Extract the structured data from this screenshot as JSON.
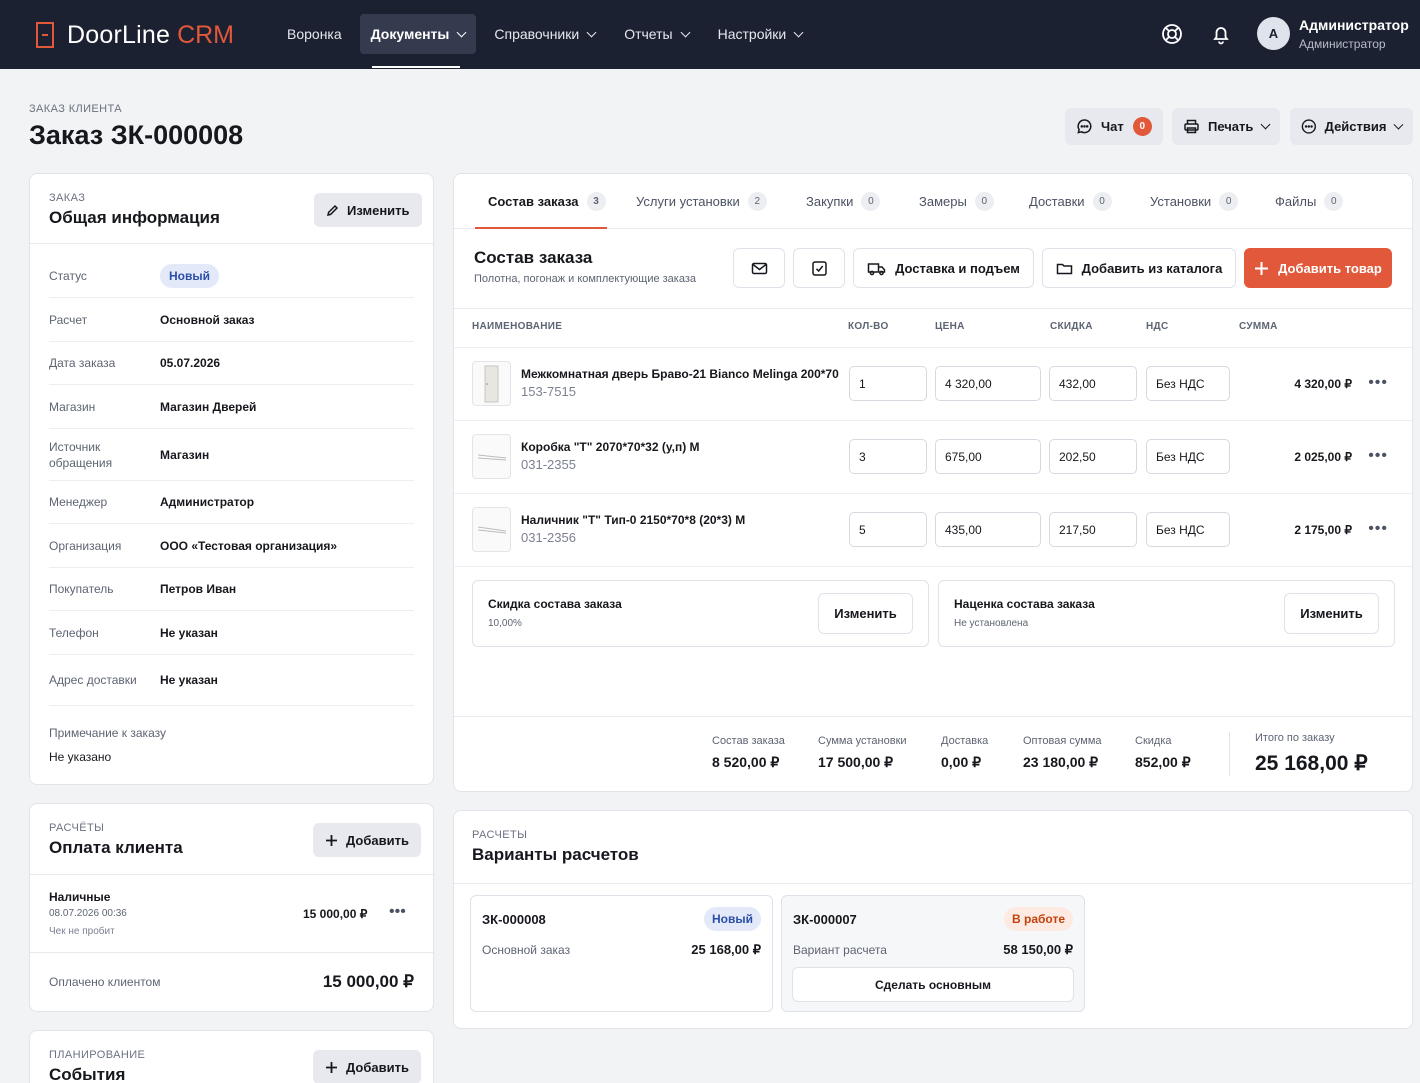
{
  "app": {
    "logo": "DoorLine",
    "logo_accent": "CRM"
  },
  "nav": [
    {
      "label": "Воронка"
    },
    {
      "label": "Документы"
    },
    {
      "label": "Справочники"
    },
    {
      "label": "Отчеты"
    },
    {
      "label": "Настройки"
    }
  ],
  "user": {
    "initial": "А",
    "name": "Администратор",
    "role": "Администратор"
  },
  "header": {
    "crumb": "ЗАКАЗ КЛИЕНТА",
    "title": "Заказ ЗК-000008",
    "chat": "Чат",
    "chat_count": "0",
    "print": "Печать",
    "actions": "Действия"
  },
  "info": {
    "label": "ЗАКАЗ",
    "title": "Общая информация",
    "edit": "Изменить",
    "rows": [
      {
        "k": "Статус",
        "v": "Новый"
      },
      {
        "k": "Расчет",
        "v": "Основной заказ"
      },
      {
        "k": "Дата заказа",
        "v": "05.07.2026"
      },
      {
        "k": "Магазин",
        "v": "Магазин Дверей"
      },
      {
        "k": "Источник обращения",
        "v": "Магазин"
      },
      {
        "k": "Менеджер",
        "v": "Администратор"
      },
      {
        "k": "Организация",
        "v": "ООО «Тестовая организация»"
      },
      {
        "k": "Покупатель",
        "v": "Петров Иван"
      },
      {
        "k": "Телефон",
        "v": "Не указан"
      },
      {
        "k": "Адрес доставки",
        "v": "Не указан"
      }
    ],
    "note_label": "Примечание к заказу",
    "note": "Не указано"
  },
  "payments": {
    "label": "РАСЧЁТЫ",
    "title": "Оплата клиента",
    "add": "Добавить",
    "item": {
      "type": "Наличные",
      "date": "08.07.2026 00:36",
      "check": "Чек не пробит",
      "amount": "15 000,00 ₽"
    },
    "paid_label": "Оплачено клиентом",
    "paid": "15 000,00 ₽"
  },
  "planning": {
    "label": "ПЛАНИРОВАНИЕ",
    "title": "События",
    "add": "Добавить"
  },
  "tabs": [
    {
      "label": "Состав заказа",
      "count": "3"
    },
    {
      "label": "Услуги установки",
      "count": "2"
    },
    {
      "label": "Закупки",
      "count": "0"
    },
    {
      "label": "Замеры",
      "count": "0"
    },
    {
      "label": "Доставки",
      "count": "0"
    },
    {
      "label": "Установки",
      "count": "0"
    },
    {
      "label": "Файлы",
      "count": "0"
    }
  ],
  "composition": {
    "title": "Состав заказа",
    "subtitle": "Полотна, погонаж и комплектующие заказа",
    "btn_delivery": "Доставка и подъем",
    "btn_catalog": "Добавить из каталога",
    "btn_add": "Добавить товар",
    "columns": {
      "name": "НАИМЕНОВАНИЕ",
      "qty": "КОЛ-ВО",
      "price": "ЦЕНА",
      "discount": "СКИДКА",
      "vat": "НДС",
      "sum": "СУММА"
    },
    "items": [
      {
        "name": "Межкомнатная дверь Браво-21 Bianco Melinga 200*70",
        "sku": "153-7515",
        "qty": "1",
        "price": "4 320,00",
        "discount": "432,00",
        "vat": "Без НДС",
        "sum": "4 320,00 ₽"
      },
      {
        "name": "Коробка \"Т\" 2070*70*32 (у,п) М",
        "sku": "031-2355",
        "qty": "3",
        "price": "675,00",
        "discount": "202,50",
        "vat": "Без НДС",
        "sum": "2 025,00 ₽"
      },
      {
        "name": "Наличник \"Т\" Тип-0 2150*70*8 (20*3) М",
        "sku": "031-2356",
        "qty": "5",
        "price": "435,00",
        "discount": "217,50",
        "vat": "Без НДС",
        "sum": "2 175,00 ₽"
      }
    ],
    "discount_card": {
      "title": "Скидка состава заказа",
      "value": "10,00%",
      "btn": "Изменить"
    },
    "markup_card": {
      "title": "Наценка состава заказа",
      "value": "Не установлена",
      "btn": "Изменить"
    },
    "totals": [
      {
        "label": "Состав заказа",
        "value": "8 520,00 ₽"
      },
      {
        "label": "Сумма установки",
        "value": "17 500,00 ₽"
      },
      {
        "label": "Доставка",
        "value": "0,00 ₽"
      },
      {
        "label": "Оптовая сумма",
        "value": "23 180,00 ₽"
      },
      {
        "label": "Скидка",
        "value": "852,00 ₽"
      }
    ],
    "grand_label": "Итого по заказу",
    "grand": "25 168,00 ₽"
  },
  "variants": {
    "label": "РАСЧЕТЫ",
    "title": "Варианты расчетов",
    "items": [
      {
        "number": "ЗК-000008",
        "status": "Новый",
        "desc": "Основной заказ",
        "amount": "25 168,00 ₽"
      },
      {
        "number": "ЗК-000007",
        "status": "В работе",
        "desc": "Вариант расчета",
        "amount": "58 150,00 ₽",
        "action": "Сделать основным"
      }
    ]
  },
  "colors": {
    "accent": "#e2583a",
    "topbar": "#1c2132",
    "status_new": "#2b4ea8",
    "status_work": "#c2410c"
  }
}
